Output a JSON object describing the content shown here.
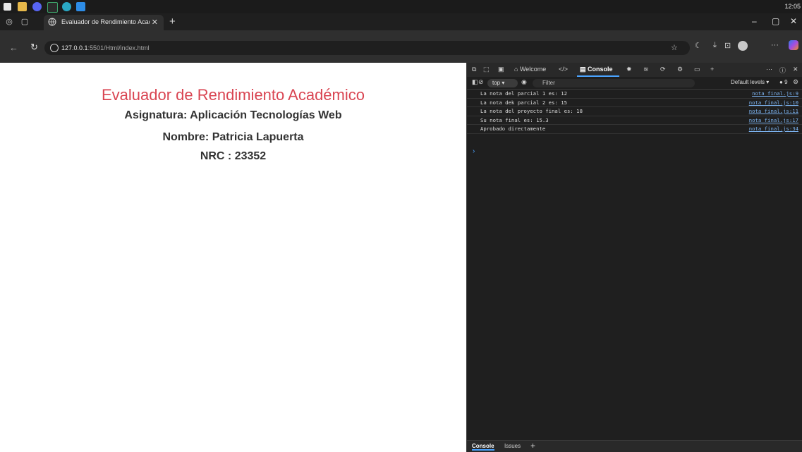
{
  "taskbar": {
    "clock": "12:05",
    "pinned": [
      {
        "name": "windows-start-icon",
        "color": "#e8e8e8"
      },
      {
        "name": "file-explorer-icon",
        "color": "#e6b84a"
      },
      {
        "name": "discord-icon",
        "color": "#5865f2"
      },
      {
        "name": "pycharm-icon",
        "color": "#3ea36a"
      },
      {
        "name": "edge-icon",
        "color": "#2aa8c4"
      },
      {
        "name": "vscode-icon",
        "color": "#2d8ce6"
      }
    ]
  },
  "browser": {
    "tab_title": "Evaluador de Rendimiento Acadé",
    "url_host": "127.0.0.1",
    "url_path": ":5501/Html/index.html"
  },
  "page": {
    "title": "Evaluador de Rendimiento Académico",
    "subject": "Asignatura: Aplicación Tecnologías Web",
    "name": "Nombre: Patricia Lapuerta",
    "nrc": "NRC : 23352",
    "title_color": "#d94552"
  },
  "devtools": {
    "tabs": {
      "welcome": "Welcome",
      "console": "Console"
    },
    "context": "top",
    "filter_placeholder": "Filter",
    "levels": "Default levels",
    "issues_count": "9",
    "logs": [
      {
        "message": "La nota del parcial 1 es: 12",
        "source": "nota_final.js:9"
      },
      {
        "message": "La nota dek parcial 2 es: 15",
        "source": "nota_final.js:10"
      },
      {
        "message": "La nota del proyecto final es: 18",
        "source": "nota_final.js:11"
      },
      {
        "message": "Su nota final es: 15.3",
        "source": "nota_final.js:17"
      },
      {
        "message": "Aprobado directamente",
        "source": "nota_final.js:34"
      }
    ],
    "drawer_tabs": {
      "console": "Console",
      "issues": "Issues"
    }
  }
}
